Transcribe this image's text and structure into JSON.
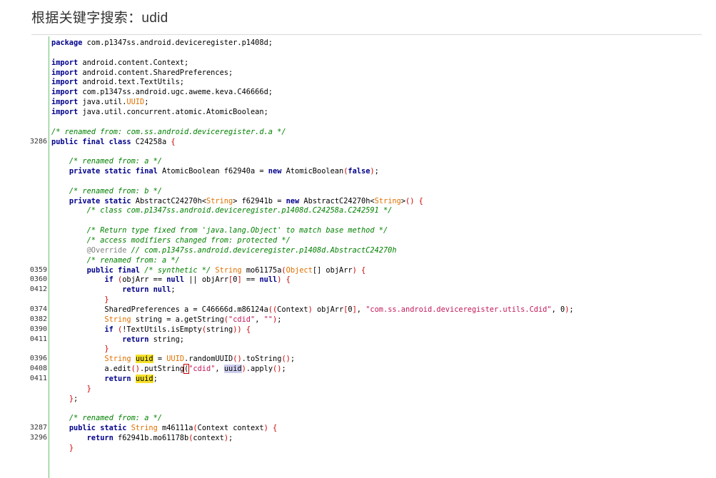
{
  "page": {
    "heading": "根据关键字搜索：udid"
  },
  "editor": {
    "lines": [
      {
        "num": "",
        "tokens": [
          {
            "t": "package",
            "c": "kw"
          },
          {
            "t": " com.p1347ss.android.deviceregister.p1408d;"
          }
        ]
      },
      {
        "num": "",
        "tokens": []
      },
      {
        "num": "",
        "tokens": [
          {
            "t": "import",
            "c": "kw"
          },
          {
            "t": " android.content.Context;"
          }
        ]
      },
      {
        "num": "",
        "tokens": [
          {
            "t": "import",
            "c": "kw"
          },
          {
            "t": " android.content.SharedPreferences;"
          }
        ]
      },
      {
        "num": "",
        "tokens": [
          {
            "t": "import",
            "c": "kw"
          },
          {
            "t": " android.text.TextUtils;"
          }
        ]
      },
      {
        "num": "",
        "tokens": [
          {
            "t": "import",
            "c": "kw"
          },
          {
            "t": " com.p1347ss.android.ugc.aweme.keva.C46666d;"
          }
        ]
      },
      {
        "num": "",
        "tokens": [
          {
            "t": "import",
            "c": "kw"
          },
          {
            "t": " java.util."
          },
          {
            "t": "UUID",
            "c": "type"
          },
          {
            "t": ";"
          }
        ]
      },
      {
        "num": "",
        "tokens": [
          {
            "t": "import",
            "c": "kw"
          },
          {
            "t": " java.util.concurrent.atomic.AtomicBoolean;"
          }
        ]
      },
      {
        "num": "",
        "tokens": []
      },
      {
        "num": "",
        "tokens": [
          {
            "t": "/* renamed from: com.ss.android.deviceregister.d.a */",
            "c": "cm"
          }
        ]
      },
      {
        "num": "3286",
        "tokens": [
          {
            "t": "public final class",
            "c": "kw"
          },
          {
            "t": " C24258a "
          },
          {
            "t": "{",
            "c": "p"
          }
        ]
      },
      {
        "num": "",
        "tokens": []
      },
      {
        "num": "",
        "tokens": [
          {
            "t": "    "
          },
          {
            "t": "/* renamed from: a */",
            "c": "cm"
          }
        ]
      },
      {
        "num": "",
        "tokens": [
          {
            "t": "    "
          },
          {
            "t": "private static final",
            "c": "kw"
          },
          {
            "t": " AtomicBoolean f62940a = "
          },
          {
            "t": "new",
            "c": "kw"
          },
          {
            "t": " AtomicBoolean"
          },
          {
            "t": "(",
            "c": "p"
          },
          {
            "t": "false",
            "c": "kw"
          },
          {
            "t": ")",
            "c": "p"
          },
          {
            "t": ";"
          }
        ]
      },
      {
        "num": "",
        "tokens": []
      },
      {
        "num": "",
        "tokens": [
          {
            "t": "    "
          },
          {
            "t": "/* renamed from: b */",
            "c": "cm"
          }
        ]
      },
      {
        "num": "",
        "tokens": [
          {
            "t": "    "
          },
          {
            "t": "private static",
            "c": "kw"
          },
          {
            "t": " AbstractC24270h<"
          },
          {
            "t": "String",
            "c": "type"
          },
          {
            "t": "> f62941b = "
          },
          {
            "t": "new",
            "c": "kw"
          },
          {
            "t": " AbstractC24270h<"
          },
          {
            "t": "String",
            "c": "type"
          },
          {
            "t": ">"
          },
          {
            "t": "() {",
            "c": "p"
          }
        ]
      },
      {
        "num": "",
        "tokens": [
          {
            "t": "        "
          },
          {
            "t": "/* class com.p1347ss.android.deviceregister.p1408d.C24258a.C242591 */",
            "c": "cm"
          }
        ]
      },
      {
        "num": "",
        "tokens": []
      },
      {
        "num": "",
        "tokens": [
          {
            "t": "        "
          },
          {
            "t": "/* Return type fixed from 'java.lang.Object' to match base method */",
            "c": "cm"
          }
        ]
      },
      {
        "num": "",
        "tokens": [
          {
            "t": "        "
          },
          {
            "t": "/* access modifiers changed from: protected */",
            "c": "cm"
          }
        ]
      },
      {
        "num": "",
        "tokens": [
          {
            "t": "        "
          },
          {
            "t": "@Override",
            "c": "ann"
          },
          {
            "t": " "
          },
          {
            "t": "// com.p1347ss.android.deviceregister.p1408d.AbstractC24270h",
            "c": "cm"
          }
        ]
      },
      {
        "num": "",
        "tokens": [
          {
            "t": "        "
          },
          {
            "t": "/* renamed from: a */",
            "c": "cm"
          }
        ]
      },
      {
        "num": "0359",
        "tokens": [
          {
            "t": "        "
          },
          {
            "t": "public final",
            "c": "kw"
          },
          {
            "t": " "
          },
          {
            "t": "/* synthetic */",
            "c": "cm"
          },
          {
            "t": " "
          },
          {
            "t": "String",
            "c": "type"
          },
          {
            "t": " mo61175a"
          },
          {
            "t": "(",
            "c": "p"
          },
          {
            "t": "Object",
            "c": "type"
          },
          {
            "t": "[] objArr"
          },
          {
            "t": ")",
            "c": "p"
          },
          {
            "t": " "
          },
          {
            "t": "{",
            "c": "p"
          }
        ]
      },
      {
        "num": "0360",
        "tokens": [
          {
            "t": "            "
          },
          {
            "t": "if",
            "c": "kw"
          },
          {
            "t": " "
          },
          {
            "t": "(",
            "c": "p"
          },
          {
            "t": "objArr == "
          },
          {
            "t": "null",
            "c": "kw"
          },
          {
            "t": " || objArr"
          },
          {
            "t": "[",
            "c": "p"
          },
          {
            "t": "0"
          },
          {
            "t": "]",
            "c": "p"
          },
          {
            "t": " == "
          },
          {
            "t": "null",
            "c": "kw"
          },
          {
            "t": ")",
            "c": "p"
          },
          {
            "t": " "
          },
          {
            "t": "{",
            "c": "p"
          }
        ]
      },
      {
        "num": "0412",
        "tokens": [
          {
            "t": "                "
          },
          {
            "t": "return null",
            "c": "kw"
          },
          {
            "t": ";"
          }
        ]
      },
      {
        "num": "",
        "tokens": [
          {
            "t": "            "
          },
          {
            "t": "}",
            "c": "p"
          }
        ]
      },
      {
        "num": "0374",
        "tokens": [
          {
            "t": "            SharedPreferences a = C46666d.m86124a"
          },
          {
            "t": "((",
            "c": "p"
          },
          {
            "t": "Context"
          },
          {
            "t": ")",
            "c": "p"
          },
          {
            "t": " objArr"
          },
          {
            "t": "[",
            "c": "p"
          },
          {
            "t": "0"
          },
          {
            "t": "]",
            "c": "p"
          },
          {
            "t": ", "
          },
          {
            "t": "\"com.ss.android.deviceregister.utils.Cdid\"",
            "c": "str"
          },
          {
            "t": ", "
          },
          {
            "t": "0"
          },
          {
            "t": ")",
            "c": "p"
          },
          {
            "t": ";"
          }
        ]
      },
      {
        "num": "0382",
        "tokens": [
          {
            "t": "            "
          },
          {
            "t": "String",
            "c": "type"
          },
          {
            "t": " string = a.getString"
          },
          {
            "t": "(",
            "c": "p"
          },
          {
            "t": "\"cdid\"",
            "c": "str"
          },
          {
            "t": ", "
          },
          {
            "t": "\"\"",
            "c": "str"
          },
          {
            "t": ")",
            "c": "p"
          },
          {
            "t": ";"
          }
        ]
      },
      {
        "num": "0390",
        "tokens": [
          {
            "t": "            "
          },
          {
            "t": "if",
            "c": "kw"
          },
          {
            "t": " "
          },
          {
            "t": "(",
            "c": "p"
          },
          {
            "t": "!TextUtils.isEmpty"
          },
          {
            "t": "(",
            "c": "p"
          },
          {
            "t": "string"
          },
          {
            "t": "))",
            "c": "p"
          },
          {
            "t": " "
          },
          {
            "t": "{",
            "c": "p"
          }
        ]
      },
      {
        "num": "0411",
        "tokens": [
          {
            "t": "                "
          },
          {
            "t": "return",
            "c": "kw"
          },
          {
            "t": " string;"
          }
        ]
      },
      {
        "num": "",
        "tokens": [
          {
            "t": "            "
          },
          {
            "t": "}",
            "c": "p"
          }
        ]
      },
      {
        "num": "0396",
        "tokens": [
          {
            "t": "            "
          },
          {
            "t": "String",
            "c": "type"
          },
          {
            "t": " "
          },
          {
            "t": "uuid",
            "c": "hl"
          },
          {
            "t": " = "
          },
          {
            "t": "UUID",
            "c": "type"
          },
          {
            "t": ".randomUUID"
          },
          {
            "t": "()",
            "c": "p"
          },
          {
            "t": ".toString"
          },
          {
            "t": "()",
            "c": "p"
          },
          {
            "t": ";"
          }
        ]
      },
      {
        "num": "0408",
        "tokens": [
          {
            "t": "            a.edit"
          },
          {
            "t": "()",
            "c": "p"
          },
          {
            "t": ".putString"
          },
          {
            "t": "(",
            "c": "cur"
          },
          {
            "t": "\"cdid\"",
            "c": "str"
          },
          {
            "t": ", "
          },
          {
            "t": "uuid",
            "c": "hl2"
          },
          {
            "t": ")",
            "c": "p"
          },
          {
            "t": ".apply"
          },
          {
            "t": "()",
            "c": "p"
          },
          {
            "t": ";"
          }
        ]
      },
      {
        "num": "0411",
        "tokens": [
          {
            "t": "            "
          },
          {
            "t": "return",
            "c": "kw"
          },
          {
            "t": " "
          },
          {
            "t": "uuid",
            "c": "hl"
          },
          {
            "t": ";"
          }
        ]
      },
      {
        "num": "",
        "tokens": [
          {
            "t": "        "
          },
          {
            "t": "}",
            "c": "p"
          }
        ]
      },
      {
        "num": "",
        "tokens": [
          {
            "t": "    "
          },
          {
            "t": "}",
            "c": "p"
          },
          {
            "t": ";"
          }
        ]
      },
      {
        "num": "",
        "tokens": []
      },
      {
        "num": "",
        "tokens": [
          {
            "t": "    "
          },
          {
            "t": "/* renamed from: a */",
            "c": "cm"
          }
        ]
      },
      {
        "num": "3287",
        "tokens": [
          {
            "t": "    "
          },
          {
            "t": "public static",
            "c": "kw"
          },
          {
            "t": " "
          },
          {
            "t": "String",
            "c": "type"
          },
          {
            "t": " m46111a"
          },
          {
            "t": "(",
            "c": "p"
          },
          {
            "t": "Context context"
          },
          {
            "t": ")",
            "c": "p"
          },
          {
            "t": " "
          },
          {
            "t": "{",
            "c": "p"
          }
        ]
      },
      {
        "num": "3296",
        "tokens": [
          {
            "t": "        "
          },
          {
            "t": "return",
            "c": "kw"
          },
          {
            "t": " f62941b.mo61178b"
          },
          {
            "t": "(",
            "c": "p"
          },
          {
            "t": "context"
          },
          {
            "t": ")",
            "c": "p"
          },
          {
            "t": ";"
          }
        ]
      },
      {
        "num": "",
        "tokens": [
          {
            "t": "    "
          },
          {
            "t": "}",
            "c": "p"
          }
        ]
      }
    ]
  }
}
